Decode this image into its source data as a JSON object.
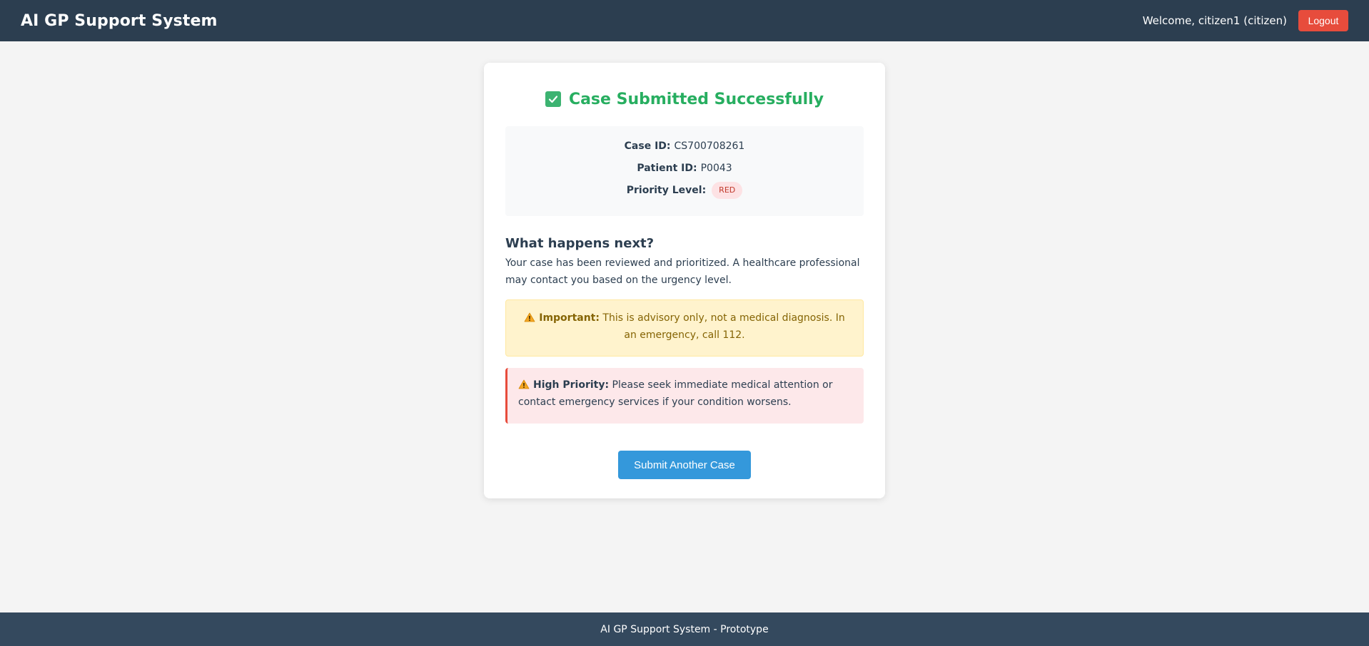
{
  "header": {
    "title": "AI GP Support System",
    "welcome": "Welcome, citizen1 (citizen)",
    "logout_label": "Logout"
  },
  "card": {
    "title": "Case Submitted Successfully",
    "icon": "check-box-icon",
    "info": {
      "case_id_label": "Case ID:",
      "case_id": "CS700708261",
      "patient_id_label": "Patient ID:",
      "patient_id": "P0043",
      "priority_label": "Priority Level:",
      "priority": "RED"
    },
    "next_heading": "What happens next?",
    "next_text": "Your case has been reviewed and prioritized. A healthcare professional may contact you based on the urgency level.",
    "important": {
      "icon": "warning-icon",
      "label": "Important:",
      "text": " This is advisory only, not a medical diagnosis. In an emergency, call 112."
    },
    "high_priority": {
      "icon": "warning-icon",
      "label": "High Priority:",
      "text": " Please seek immediate medical attention or contact emergency services if your condition worsens."
    },
    "submit_another_label": "Submit Another Case"
  },
  "footer": {
    "text": "AI GP Support System - Prototype"
  },
  "colors": {
    "header_bg": "#2c3e50",
    "footer_bg": "#34495e",
    "success": "#27ae60",
    "logout": "#e74c3c",
    "primary_button": "#3498db",
    "priority_red": "#c0392b"
  }
}
